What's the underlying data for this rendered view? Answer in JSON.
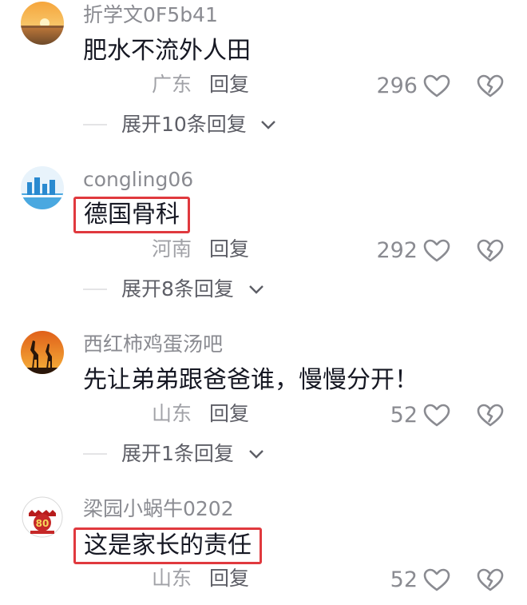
{
  "comments": [
    {
      "username": "折学文0F5b41",
      "text": "肥水不流外人田",
      "location": "广东",
      "reply_label": "回复",
      "likes": "296",
      "expand_label": "展开10条回复",
      "highlighted": false
    },
    {
      "username": "congling06",
      "text": "德国骨科",
      "location": "河南",
      "reply_label": "回复",
      "likes": "292",
      "expand_label": "展开8条回复",
      "highlighted": true
    },
    {
      "username": "西红柿鸡蛋汤吧",
      "text": "先让弟弟跟爸爸谁，慢慢分开！",
      "location": "山东",
      "reply_label": "回复",
      "likes": "52",
      "expand_label": "展开1条回复",
      "highlighted": false
    },
    {
      "username": "梁园小蜗牛0202",
      "text": "这是家长的责任",
      "location": "山东",
      "reply_label": "回复",
      "likes": "52",
      "highlighted": true
    }
  ],
  "colors": {
    "highlight_box": "#e0393e",
    "username": "#8a8b91",
    "text": "#161823",
    "location": "#a1a2a7",
    "action": "#5d5e66"
  },
  "icons": {
    "like": "heart-outline-icon",
    "dislike": "broken-heart-icon",
    "expand": "chevron-down-icon"
  },
  "avatar_badge_text": "80"
}
